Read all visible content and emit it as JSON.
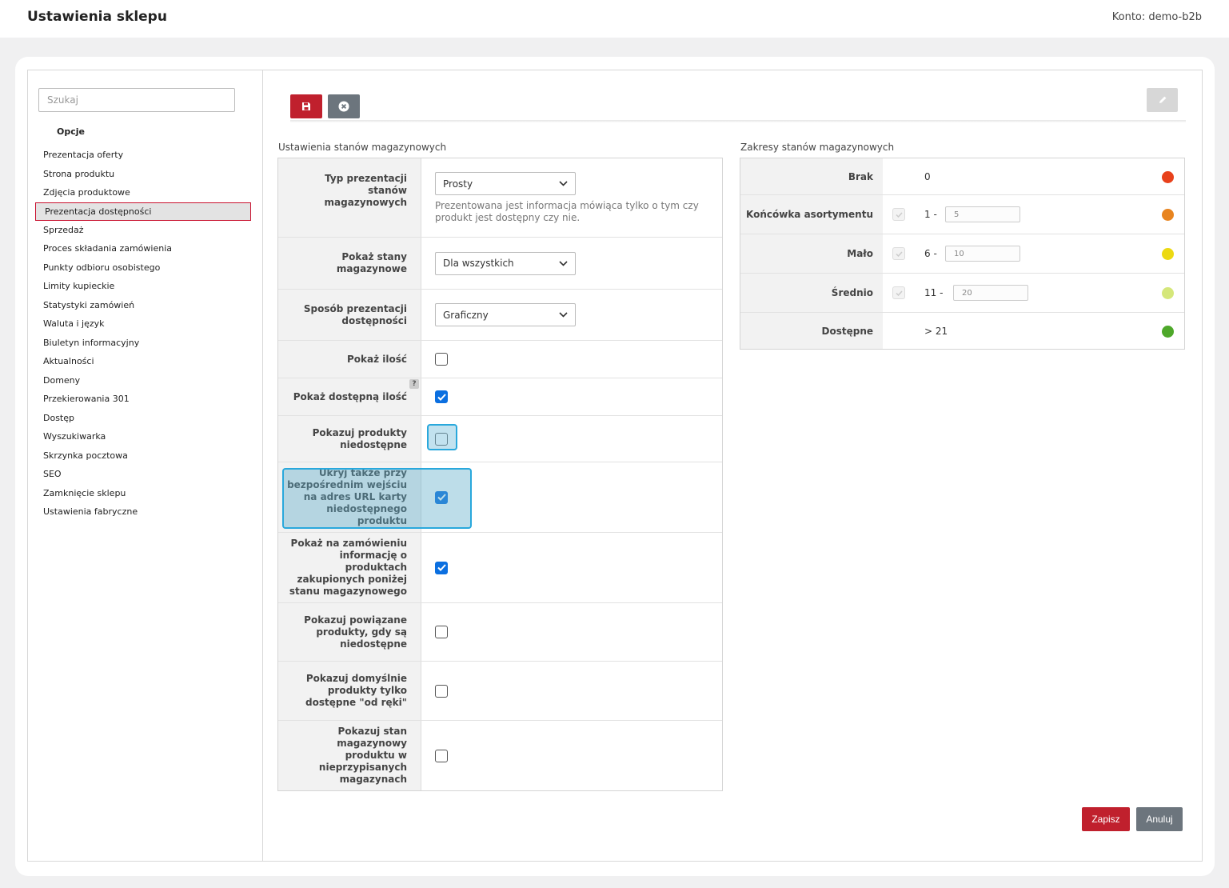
{
  "header": {
    "title": "Ustawienia sklepu",
    "account_label": "Konto:",
    "account_name": "demo-b2b"
  },
  "sidebar": {
    "search_placeholder": "Szukaj",
    "section": "Opcje",
    "items": [
      "Prezentacja oferty",
      "Strona produktu",
      "Zdjęcia produktowe",
      "Prezentacja dostępności",
      "Sprzedaż",
      "Proces składania zamówienia",
      "Punkty odbioru osobistego",
      "Limity kupieckie",
      "Statystyki zamówień",
      "Waluta i język",
      "Biuletyn informacyjny",
      "Aktualności",
      "Domeny",
      "Przekierowania 301",
      "Dostęp",
      "Wyszukiwarka",
      "Skrzynka pocztowa",
      "SEO",
      "Zamknięcie sklepu",
      "Ustawienia fabryczne"
    ],
    "active_index": 3
  },
  "toolbar": {
    "save_icon": "floppy-disk-icon",
    "cancel_icon": "circle-x-icon",
    "edit_icon": "pencil-icon"
  },
  "stock": {
    "title": "Ustawienia stanów magazynowych",
    "presentation_type": {
      "label": "Typ prezentacji stanów magazynowych",
      "value": "Prosty",
      "hint": "Prezentowana jest informacja mówiąca tylko o tym czy produkt jest dostępny czy nie."
    },
    "show_stock": {
      "label": "Pokaż stany magazynowe",
      "value": "Dla wszystkich"
    },
    "availability_mode": {
      "label": "Sposób prezentacji dostępności",
      "value": "Graficzny"
    },
    "show_quantity": {
      "label": "Pokaż ilość",
      "checked": false
    },
    "show_available_quantity": {
      "label": "Pokaż dostępną ilość",
      "checked": true,
      "help": "?"
    },
    "show_unavailable": {
      "label": "Pokazuj produkty niedostępne",
      "checked": false
    },
    "hide_direct_url": {
      "label": "Ukryj także przy bezpośrednim wejściu na adres URL karty niedostępnego produktu",
      "checked": true
    },
    "order_below_stock": {
      "label": "Pokaż na zamówieniu informację o produktach zakupionych poniżej stanu magazynowego",
      "checked": true
    },
    "related_unavailable": {
      "label": "Pokazuj powiązane produkty, gdy są niedostępne",
      "checked": false
    },
    "default_in_hand": {
      "label": "Pokazuj domyślnie produkty tylko dostępne \"od ręki\"",
      "checked": false
    },
    "unassigned_warehouses": {
      "label": "Pokazuj stan magazynowy produktu w nieprzypisanych magazynach",
      "checked": false
    }
  },
  "ranges": {
    "title": "Zakresy stanów magazynowych",
    "rows": [
      {
        "label": "Brak",
        "from": "0",
        "to": "",
        "color": "#e8411b"
      },
      {
        "label": "Końcówka asortymentu",
        "from": "1 -",
        "to": "5",
        "color": "#e8841f"
      },
      {
        "label": "Mało",
        "from": "6 -",
        "to": "10",
        "color": "#ecd912"
      },
      {
        "label": "Średnio",
        "from": "11 -",
        "to": "20",
        "color": "#d5e77a"
      },
      {
        "label": "Dostępne",
        "from": "> 21",
        "to": "",
        "color": "#4ea82a"
      }
    ]
  },
  "actions": {
    "save": "Zapisz",
    "cancel": "Anuluj"
  },
  "colors": {
    "accent_red": "#c0202d",
    "gray_button": "#6c757d",
    "checkbox_blue": "#0b6fe0",
    "highlight": "#29a8dc"
  }
}
